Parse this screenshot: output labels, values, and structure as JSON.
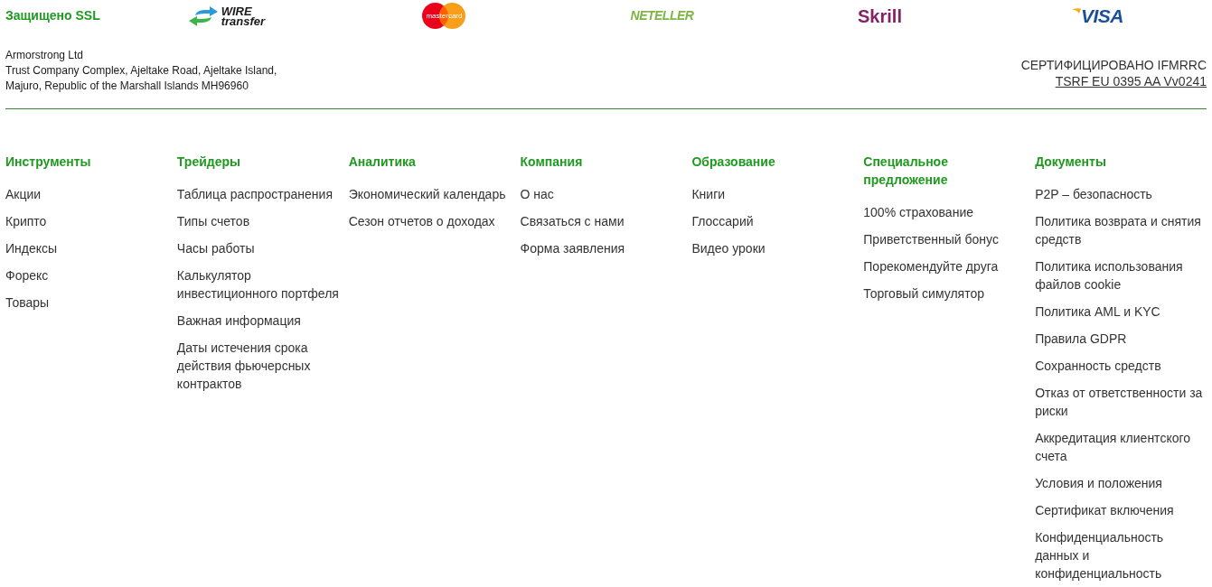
{
  "security_badge": {
    "text": "Защищено SSL"
  },
  "payment_logos": [
    {
      "kind": "wire_transfer",
      "lines": [
        "WIRE",
        "transfer"
      ]
    },
    {
      "kind": "mastercard",
      "lines": [
        "mastercard"
      ]
    },
    {
      "kind": "neteller",
      "lines": [
        "NETELLER"
      ]
    },
    {
      "kind": "skrill",
      "lines": [
        "Skrill"
      ]
    },
    {
      "kind": "visa",
      "lines": [
        "VISA"
      ]
    }
  ],
  "company": {
    "name": "Armorstrong Ltd",
    "address_lines": [
      "Trust Company Complex, Ajeltake Road, Ajeltake Island,",
      "Majuro, Republic of the Marshall Islands MH96960"
    ]
  },
  "certification": {
    "label": "СЕРТИФИЦИРОВАНО IFMRRC",
    "link": "TSRF EU 0395 AA Vv0241"
  },
  "footer_columns": [
    {
      "heading": "Инструменты",
      "links": [
        "Акции",
        "Крипто",
        "Индексы",
        "Форекс",
        "Товары"
      ]
    },
    {
      "heading": "Трейдеры",
      "links": [
        "Таблица распространения",
        "Типы счетов",
        "Часы работы",
        "Калькулятор инвестиционного портфеля",
        "Важная информация",
        "Даты истечения срока действия фьючерсных контрактов"
      ]
    },
    {
      "heading": "Аналитика",
      "links": [
        "Экономический календарь",
        "Сезон отчетов о доходах"
      ]
    },
    {
      "heading": "Компания",
      "links": [
        "О нас",
        "Связаться с нами",
        "Форма заявления"
      ]
    },
    {
      "heading": "Образование",
      "links": [
        "Книги",
        "Глоссарий",
        "Видео уроки"
      ]
    },
    {
      "heading": "Специальное предложение",
      "links": [
        "100% страхование",
        "Приветственный бонус",
        "Порекомендуйте друга",
        "Торговый симулятор"
      ]
    },
    {
      "heading": "Документы",
      "links": [
        "P2P – безопасность",
        "Политика возврата и снятия средств",
        "Политика использования файлов cookie",
        "Политика AML и KYC",
        "Правила GDPR",
        "Сохранность средств",
        "Отказ от ответственности за риски",
        "Аккредитация клиентского счета",
        "Условия и положения",
        "Сертификат включения",
        "Конфиденциальность данных и конфиденциальность"
      ]
    }
  ]
}
